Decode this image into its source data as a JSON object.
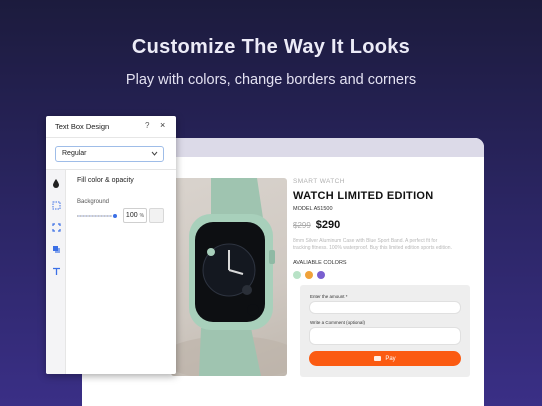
{
  "hero": {
    "title": "Customize The Way It Looks",
    "subtitle": "Play with colors, change borders and corners"
  },
  "panel": {
    "title": "Text Box Design",
    "help_icon": "?",
    "close_icon": "×",
    "select_value": "Regular",
    "section_title": "Fill color & opacity",
    "background_label": "Background",
    "opacity_value": "100",
    "opacity_unit": "%",
    "rail_icons": [
      "fill-drop-icon",
      "border-dashed-icon",
      "corners-icon",
      "shadow-icon",
      "text-icon"
    ]
  },
  "product": {
    "eyebrow": "SMART WATCH",
    "title": "WATCH LIMITED EDITION",
    "model": "MODEL A51500",
    "old_price": "$299",
    "new_price": "$290",
    "description": "8mm Silver Aluminum Case with Blue Sport Band. A perfect fit for tracking fitness. 100% waterproof. Buy this limited edition sports edition.",
    "colors_label": "AVALIABLE COLORS",
    "swatch_colors": [
      "#b8e2c6",
      "#f0a23a",
      "#7a5fd0"
    ]
  },
  "form": {
    "amount_label": "Enter the amount *",
    "comment_label": "Write a Comment (optional)",
    "play_label": "Pay",
    "button_color": "#fb5b12"
  }
}
